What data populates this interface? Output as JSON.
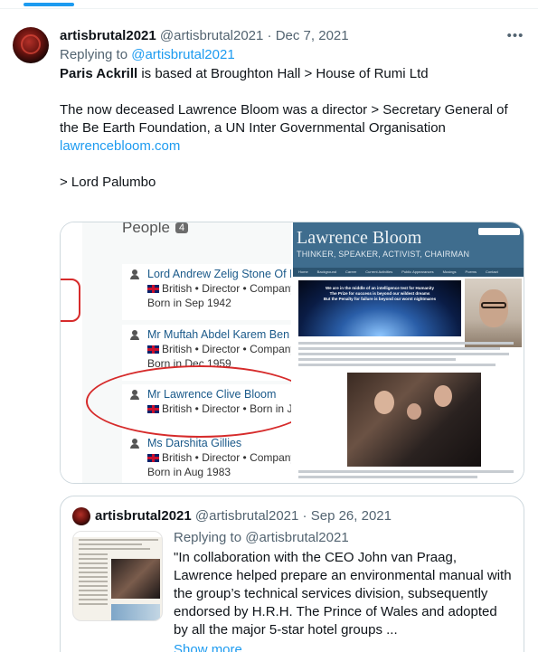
{
  "tweet": {
    "display_name": "artisbrutal2021",
    "handle": "@artisbrutal2021",
    "separator": " · ",
    "date": "Dec 7, 2021",
    "more_icon": "more-horizontal-icon",
    "replying_prefix": "Replying to ",
    "replying_to": "@artisbrutal2021",
    "line1_bold": "Paris Ackrill",
    "line1_rest": " is based at Broughton Hall > House of Rumi Ltd",
    "line2": "The now deceased Lawrence Bloom was a director > Secretary General of the Be Earth Foundation, a UN Inter Governmental Organisation",
    "link": "lawrencebloom.com",
    "line3": "> Lord Palumbo"
  },
  "media_left": {
    "title": "People",
    "count": "4",
    "people": [
      {
        "name": "Lord Andrew Zelig Stone Of I",
        "details": "British • Director • Company",
        "born": "Born in Sep 1942"
      },
      {
        "name": "Mr Muftah Abdel Karem Ben",
        "details": "British • Director • Company",
        "born": "Born in Dec 1959"
      },
      {
        "name": "Mr Lawrence Clive Bloom",
        "details": "British • Director • Born in Ju",
        "born": ""
      },
      {
        "name": "Ms Darshita Gillies",
        "details": "British • Director • Company",
        "born": "Born in Aug 1983"
      }
    ]
  },
  "media_right": {
    "site_title": "Lawrence Bloom",
    "site_subtitle": "THINKER, SPEAKER, ACTIVIST, CHAIRMAN",
    "nav": [
      "Home",
      "Background",
      "Career",
      "Current Activities",
      "Public Appearances",
      "Musings",
      "Poems",
      "Contact"
    ],
    "panel_lines": [
      "We are in the middle of an intelligence test for Humanity",
      "The Prize for success is beyond our wildest dreams",
      "But the Penalty for failure is beyond our worst nightmares"
    ]
  },
  "quote": {
    "display_name": "artisbrutal2021",
    "handle": "@artisbrutal2021",
    "separator": " · ",
    "date": "Sep 26, 2021",
    "replying_prefix": "Replying to ",
    "replying_to": "@artisbrutal2021",
    "text": "\"In collaboration with the CEO John van Praag, Lawrence helped prepare an environmental manual with the group’s technical services division, subsequently endorsed by H.R.H. The Prince of Wales and adopted by all the major 5-star hotel groups ...",
    "show_more": "Show more"
  },
  "colors": {
    "accent": "#1d9bf0",
    "text_primary": "#0f1419",
    "text_secondary": "#536471",
    "border": "#cfd9de",
    "annotation_red": "#d62b2b"
  }
}
